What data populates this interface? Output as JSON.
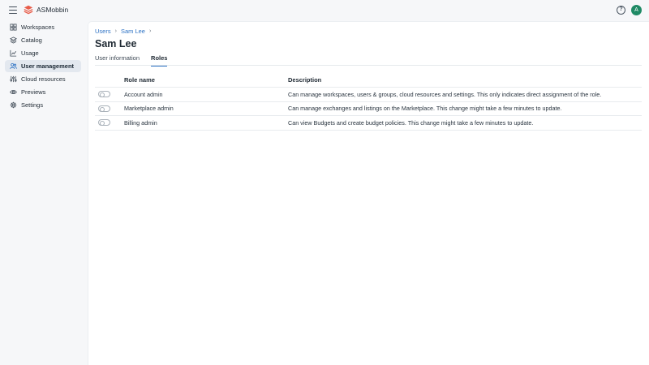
{
  "app": {
    "name": "ASMobbin",
    "avatar_initial": "A",
    "help_symbol": "?"
  },
  "colors": {
    "accent": "#2d72c4",
    "avatar": "#1f8a65",
    "logo": "#e85d4a",
    "active_nav_bg": "#e3e8ef"
  },
  "sidebar": {
    "items": [
      {
        "label": "Workspaces",
        "icon": "workspaces-icon"
      },
      {
        "label": "Catalog",
        "icon": "catalog-icon"
      },
      {
        "label": "Usage",
        "icon": "usage-chart-icon"
      },
      {
        "label": "User management",
        "icon": "users-icon",
        "active": true
      },
      {
        "label": "Cloud resources",
        "icon": "sliders-icon"
      },
      {
        "label": "Previews",
        "icon": "eye-icon"
      },
      {
        "label": "Settings",
        "icon": "gear-icon"
      }
    ]
  },
  "breadcrumb": {
    "items": [
      "Users",
      "Sam Lee"
    ],
    "separator": "›"
  },
  "page": {
    "title": "Sam Lee"
  },
  "tabs": [
    {
      "label": "User information"
    },
    {
      "label": "Roles",
      "active": true
    }
  ],
  "roles_table": {
    "headers": {
      "role": "Role name",
      "description": "Description"
    },
    "rows": [
      {
        "role": "Account admin",
        "description": "Can manage workspaces, users & groups, cloud resources and settings. This only indicates direct assignment of the role.",
        "enabled": false
      },
      {
        "role": "Marketplace admin",
        "description": "Can manage exchanges and listings on the Marketplace. This change might take a few minutes to update.",
        "enabled": false
      },
      {
        "role": "Billing admin",
        "description": "Can view Budgets and create budget policies. This change might take a few minutes to update.",
        "enabled": false
      }
    ]
  }
}
